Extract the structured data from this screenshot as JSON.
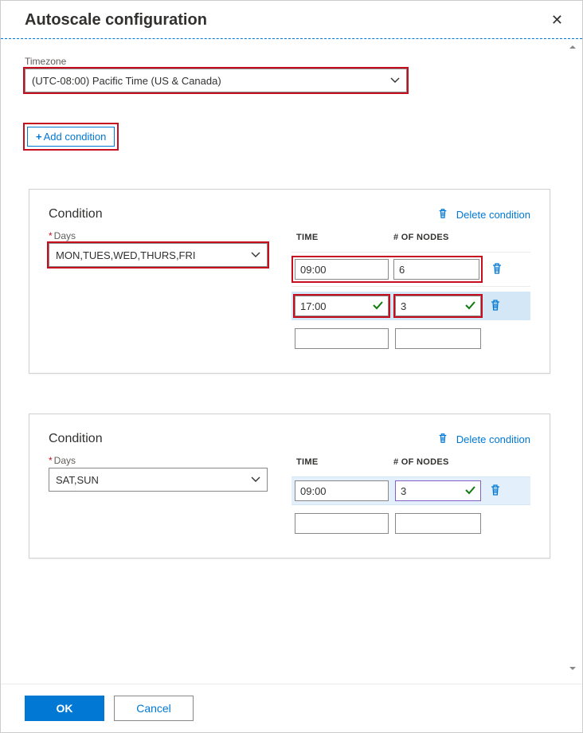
{
  "header": {
    "title": "Autoscale configuration"
  },
  "timezone": {
    "label": "Timezone",
    "value": "(UTC-08:00) Pacific Time (US & Canada)"
  },
  "add_condition_label": "Add condition",
  "condition_title": "Condition",
  "delete_condition_label": "Delete condition",
  "days_label": "Days",
  "columns": {
    "time": "TIME",
    "nodes": "# OF NODES"
  },
  "conditions": [
    {
      "days": "MON,TUES,WED,THURS,FRI",
      "rows": [
        {
          "time": "09:00",
          "nodes": "6",
          "time_valid": false,
          "nodes_valid": false,
          "highlight": "red-combined",
          "has_trash": true,
          "row_bg": "plain"
        },
        {
          "time": "17:00",
          "nodes": "3",
          "time_valid": true,
          "nodes_valid": true,
          "highlight": "red-split",
          "has_trash": true,
          "row_bg": "blue"
        },
        {
          "time": "",
          "nodes": "",
          "time_valid": false,
          "nodes_valid": false,
          "highlight": "none",
          "has_trash": false,
          "row_bg": "plain"
        }
      ]
    },
    {
      "days": "SAT,SUN",
      "rows": [
        {
          "time": "09:00",
          "nodes": "3",
          "time_valid": false,
          "nodes_valid": true,
          "highlight": "none",
          "has_trash": true,
          "row_bg": "blue-light",
          "nodes_purple": true
        },
        {
          "time": "",
          "nodes": "",
          "time_valid": false,
          "nodes_valid": false,
          "highlight": "none",
          "has_trash": false,
          "row_bg": "plain"
        }
      ]
    }
  ],
  "footer": {
    "ok": "OK",
    "cancel": "Cancel"
  }
}
